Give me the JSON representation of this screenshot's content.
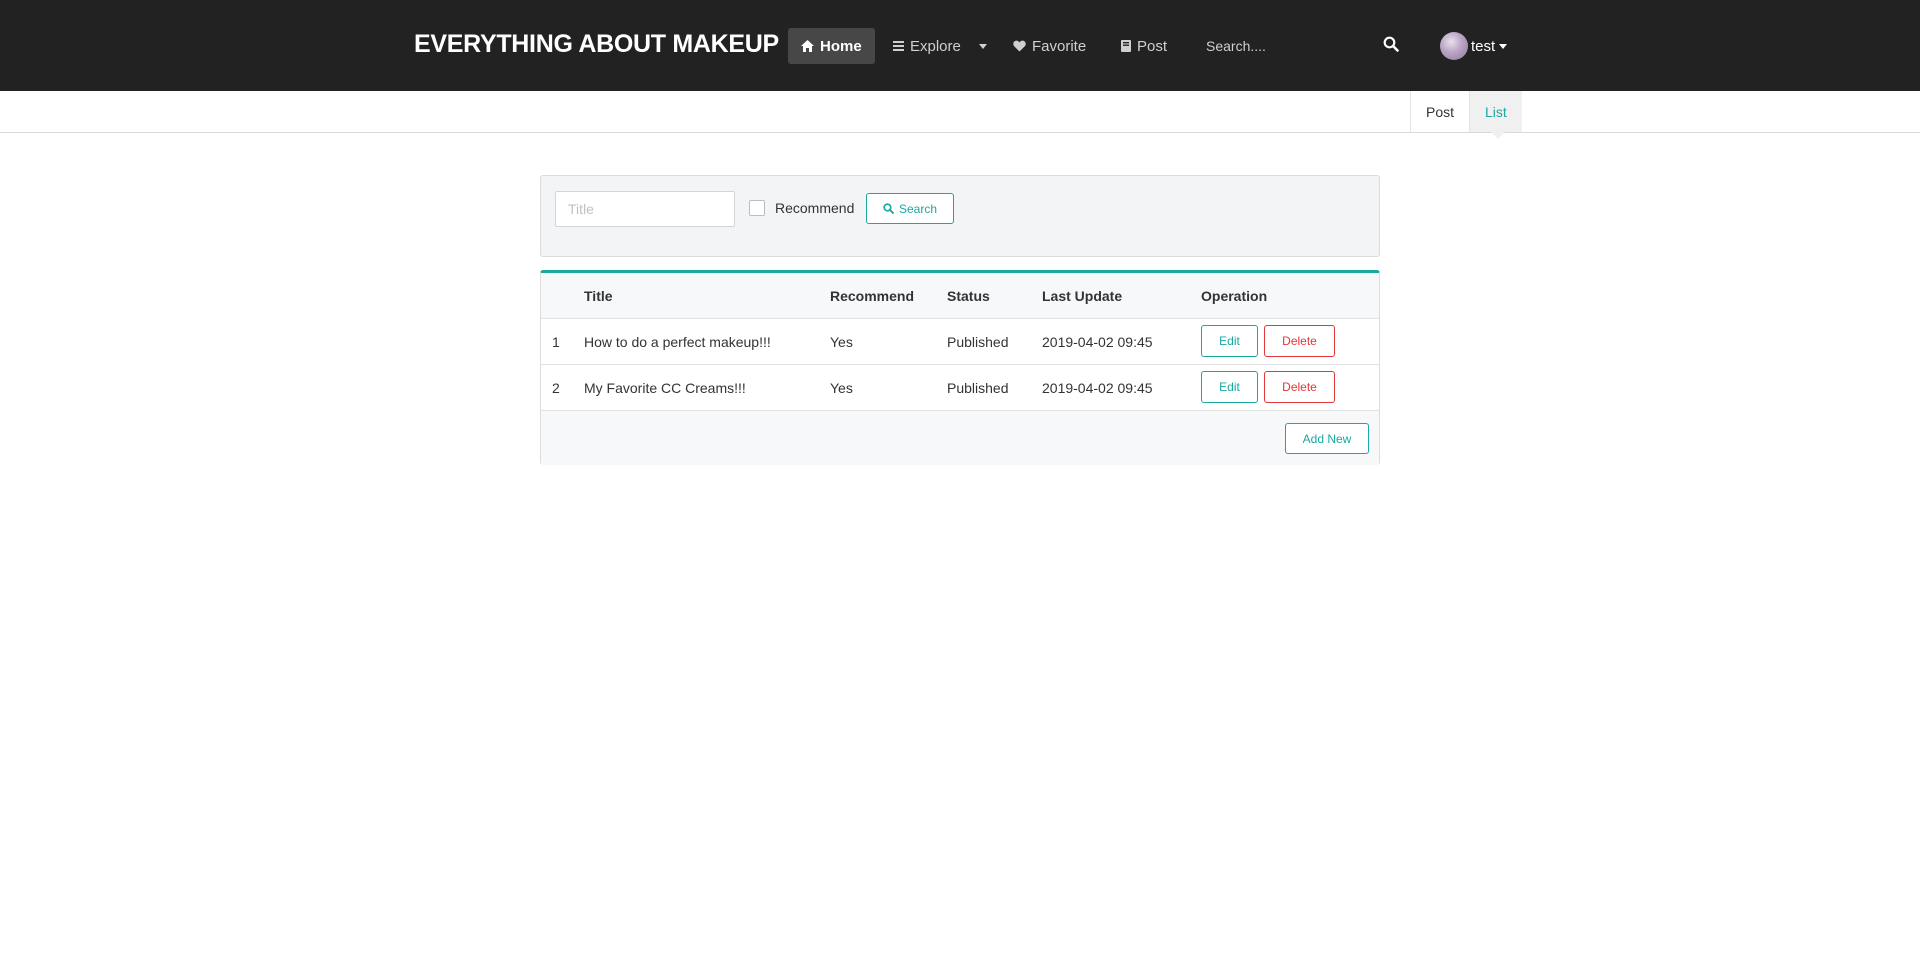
{
  "navbar": {
    "brand": "EVERYTHING ABOUT MAKEUP",
    "items": [
      {
        "label": "Home",
        "icon": "home-icon",
        "active": true
      },
      {
        "label": "Explore",
        "icon": "bars-icon",
        "dropdown": true
      },
      {
        "label": "Favorite",
        "icon": "heart-icon"
      },
      {
        "label": "Post",
        "icon": "book-icon"
      }
    ],
    "search_placeholder": "Search....",
    "user_name": "test"
  },
  "subnav": {
    "tabs": [
      {
        "label": "Post",
        "active": false
      },
      {
        "label": "List",
        "active": true
      }
    ]
  },
  "filter": {
    "title_placeholder": "Title",
    "recommend_label": "Recommend",
    "recommend_checked": false,
    "search_label": "Search"
  },
  "table": {
    "headers": [
      "",
      "Title",
      "Recommend",
      "Status",
      "Last Update",
      "Operation"
    ],
    "rows": [
      {
        "num": "1",
        "title": "How to do a perfect makeup!!!",
        "recommend": "Yes",
        "status": "Published",
        "last_update": "2019-04-02 09:45"
      },
      {
        "num": "2",
        "title": "My Favorite CC Creams!!!",
        "recommend": "Yes",
        "status": "Published",
        "last_update": "2019-04-02 09:45"
      }
    ],
    "edit_label": "Edit",
    "delete_label": "Delete",
    "add_new_label": "Add New"
  },
  "colors": {
    "navbar_bg": "#222222",
    "accent": "#1aa8a0",
    "danger": "#e0373a"
  }
}
